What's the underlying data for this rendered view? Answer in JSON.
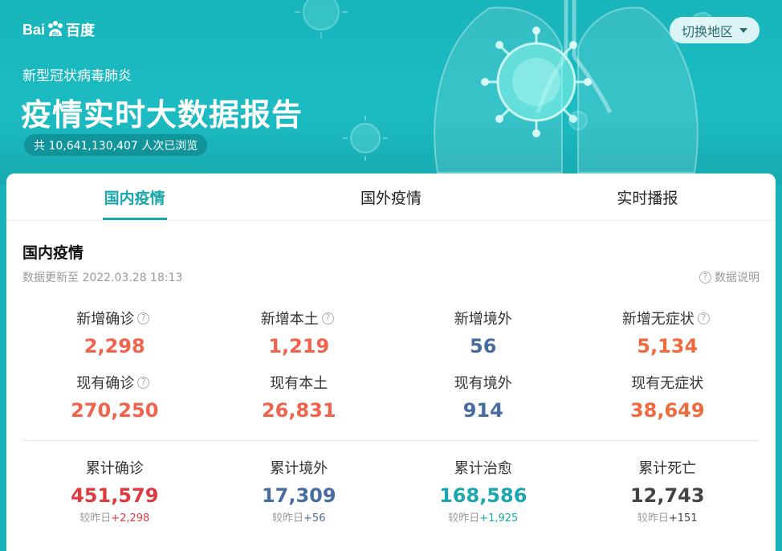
{
  "brand": {
    "logo_text_1": "Bai",
    "logo_text_2": "百度"
  },
  "region_button": {
    "label": "切换地区"
  },
  "hero": {
    "subtitle": "新型冠状病毒肺炎",
    "title": "疫情实时大数据报告",
    "views": "共 10,641,130,407 人次已浏览"
  },
  "tabs": [
    {
      "label": "国内疫情",
      "active": true
    },
    {
      "label": "国外疫情",
      "active": false
    },
    {
      "label": "实时播报",
      "active": false
    }
  ],
  "section": {
    "title": "国内疫情",
    "updated": "数据更新至 2022.03.28 18:13",
    "explain": "数据说明"
  },
  "stats_row1": [
    {
      "label": "新增确诊",
      "value": "2,298",
      "color": "#f0634d",
      "help": true
    },
    {
      "label": "新增本土",
      "value": "1,219",
      "color": "#f0634d",
      "help": true
    },
    {
      "label": "新增境外",
      "value": "56",
      "color": "#476da0",
      "help": false
    },
    {
      "label": "新增无症状",
      "value": "5,134",
      "color": "#ee6a3f",
      "help": true
    }
  ],
  "stats_row2": [
    {
      "label": "现有确诊",
      "value": "270,250",
      "color": "#f0634d",
      "help": true
    },
    {
      "label": "现有本土",
      "value": "26,831",
      "color": "#f0634d",
      "help": false
    },
    {
      "label": "现有境外",
      "value": "914",
      "color": "#476da0",
      "help": false
    },
    {
      "label": "现有无症状",
      "value": "38,649",
      "color": "#ee6a3f",
      "help": false
    }
  ],
  "stats_row3": [
    {
      "label": "累计确诊",
      "value": "451,579",
      "color": "#e03a3e",
      "diff_prefix": "较昨日",
      "diff": "+2,298",
      "diff_color": "#e03a3e"
    },
    {
      "label": "累计境外",
      "value": "17,309",
      "color": "#476da0",
      "diff_prefix": "较昨日",
      "diff": "+56",
      "diff_color": "#476da0"
    },
    {
      "label": "累计治愈",
      "value": "168,586",
      "color": "#1aa7ad",
      "diff_prefix": "较昨日",
      "diff": "+1,925",
      "diff_color": "#1aa7ad"
    },
    {
      "label": "累计死亡",
      "value": "12,743",
      "color": "#444444",
      "diff_prefix": "较昨日",
      "diff": "+151",
      "diff_color": "#444444"
    }
  ]
}
